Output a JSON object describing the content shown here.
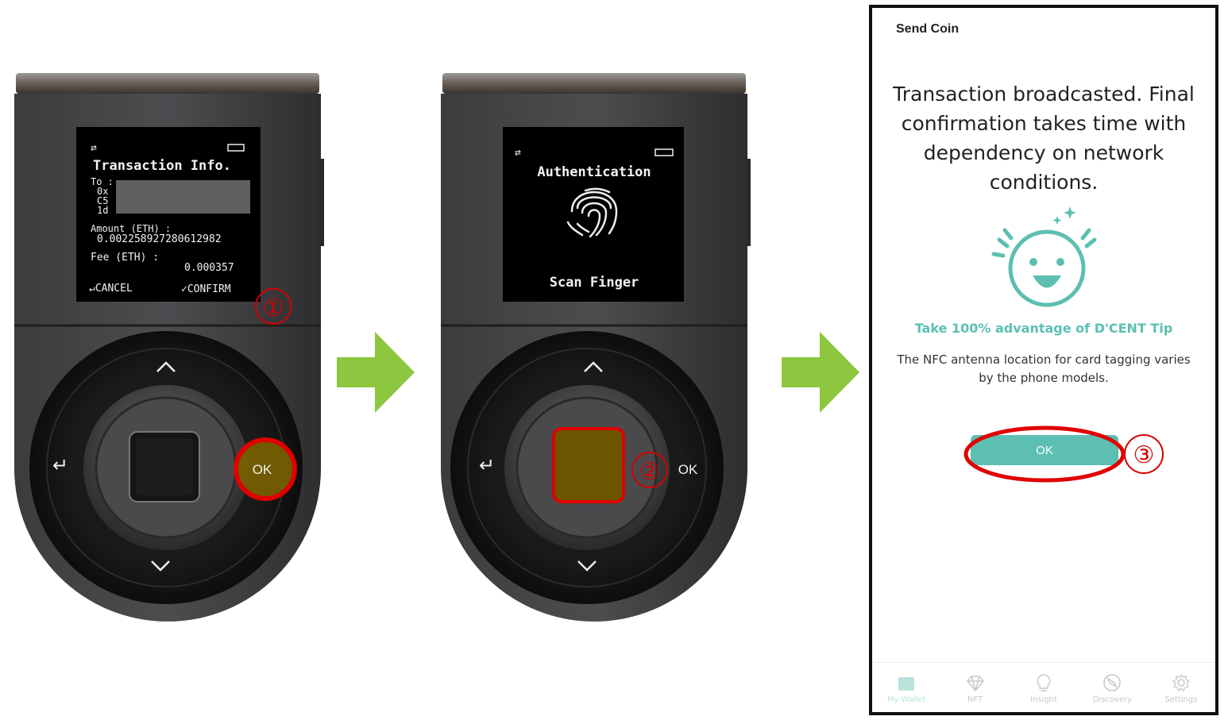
{
  "device1": {
    "screen_title": "Transaction Info.",
    "to_label": "To :",
    "addr_lines": [
      "0x",
      "C5",
      "1d"
    ],
    "amount_label": "Amount (ETH) :",
    "amount_value": "0.002258927280612982",
    "fee_label": "Fee (ETH) :",
    "fee_value": "0.000357",
    "cancel_label": "↵CANCEL",
    "confirm_label": "✓CONFIRM",
    "ok_label": "OK",
    "step_marker": "①"
  },
  "device2": {
    "screen_title": "Authentication",
    "prompt": "Scan Finger",
    "ok_label": "OK",
    "step_marker": "②"
  },
  "phone": {
    "title": "Send Coin",
    "message": "Transaction broadcasted. Final confirmation takes time with dependency on network conditions.",
    "tip_title": "Take 100% advantage of D'CENT Tip",
    "tip_body": "The NFC antenna location for card tagging varies by the phone models.",
    "ok_button": "OK",
    "step_marker": "③",
    "tabs": [
      {
        "label": "My Wallet",
        "icon": "wallet-icon",
        "active": true
      },
      {
        "label": "NFT",
        "icon": "diamond-icon",
        "active": false
      },
      {
        "label": "Insight",
        "icon": "lightbulb-icon",
        "active": false
      },
      {
        "label": "Discovery",
        "icon": "compass-icon",
        "active": false
      },
      {
        "label": "Settings",
        "icon": "gear-icon",
        "active": false
      }
    ]
  },
  "colors": {
    "arrow": "#8dc63f",
    "highlight": "#e00000",
    "accent": "#5cbfb2",
    "ok_overlay": "#7a6200"
  }
}
